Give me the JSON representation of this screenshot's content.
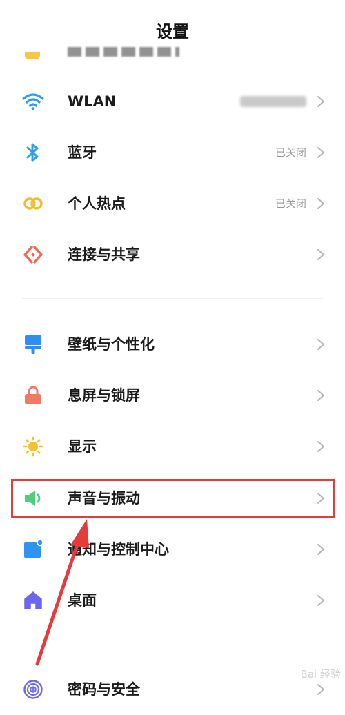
{
  "header": {
    "title": "设置"
  },
  "rows": [
    {
      "name": "wlan",
      "label": "WLAN",
      "value": "",
      "value_blurred": true,
      "icon": "wifi-icon"
    },
    {
      "name": "bluetooth",
      "label": "蓝牙",
      "value": "已关闭",
      "icon": "bluetooth-icon"
    },
    {
      "name": "hotspot",
      "label": "个人热点",
      "value": "已关闭",
      "icon": "hotspot-icon"
    },
    {
      "name": "connection-sharing",
      "label": "连接与共享",
      "value": "",
      "icon": "connection-share-icon"
    },
    {
      "name": "wallpaper",
      "label": "壁纸与个性化",
      "value": "",
      "icon": "wallpaper-icon"
    },
    {
      "name": "lockscreen",
      "label": "息屏与锁屏",
      "value": "",
      "icon": "lock-icon"
    },
    {
      "name": "display",
      "label": "显示",
      "value": "",
      "icon": "sun-icon"
    },
    {
      "name": "sound",
      "label": "声音与振动",
      "value": "",
      "icon": "speaker-icon"
    },
    {
      "name": "notifications",
      "label": "通知与控制中心",
      "value": "",
      "icon": "notification-icon"
    },
    {
      "name": "home-screen",
      "label": "桌面",
      "value": "",
      "icon": "home-icon"
    },
    {
      "name": "passwords",
      "label": "密码与安全",
      "value": "",
      "icon": "fingerprint-icon"
    }
  ],
  "colors": {
    "highlight": "#e53b3b",
    "arrow": "#e53b3b",
    "wifi": "#2f9cf0",
    "bluetooth": "#2f9cf0",
    "hotspot": "#f5b92d",
    "connection": "#ef6a51",
    "wallpaper": "#2d8ef3",
    "lock": "#f07b62",
    "sun": "#f6c12a",
    "speaker": "#4fce7b",
    "notification": "#2f93f1",
    "home": "#6b66f0",
    "fingerprint": "#6b66f0"
  },
  "watermark": {
    "text": "Bai 经验"
  }
}
